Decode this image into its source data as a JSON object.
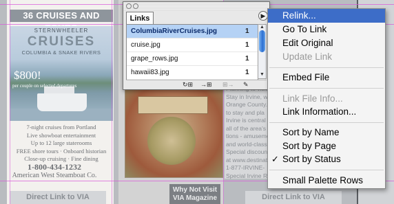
{
  "document": {
    "cruise_header": "36 CRUISES AND TOURS",
    "sternwheeler": "STERNWHEELER",
    "cruises": "CRUISES",
    "rivers": "COLUMBIA & SNAKE RIVERS",
    "price": "$800!",
    "price_note": "per couple on selected departures",
    "description_lines": [
      "7-night cruises from Portland",
      "Live showboat entertainment",
      "Up to 12 large staterooms",
      "FREE shore tours · Onboard historian",
      "Close-up cruising · Fine dining"
    ],
    "phone": "1-800-434-1232",
    "company": "American West Steamboat Co.",
    "direct_link_left": "Direct Link to VIA",
    "direct_link_right": "Direct Link to VIA",
    "why_not_visit": "Why Not Visit\nVIA Magazine",
    "right_text": "Planning to visit\nStay in Irvine, w\nOrange County.\nto stay and pla\nIrvine is central\nall of the area's\ntions - amuseme\nand world-class\nSpecial discount\nat www.destinati\n1-877-IRVINE-\nSpecial Irvine R"
  },
  "links_palette": {
    "tab_label": "Links",
    "menu_button_glyph": "▶",
    "rows": [
      {
        "name": "ColumbiaRiverCruises.jpg",
        "page": "1",
        "selected": true
      },
      {
        "name": "cruise.jpg",
        "page": "1",
        "selected": false
      },
      {
        "name": "grape_rows.jpg",
        "page": "1",
        "selected": false
      },
      {
        "name": "hawaii83.jpg",
        "page": "1",
        "selected": false
      }
    ],
    "scroll_up": "▲",
    "scroll_down": "▼",
    "toolbar": {
      "relink": "↻⊞",
      "goto": "→⊞",
      "update": "⊞→",
      "edit": "✎"
    }
  },
  "context_menu": {
    "items": [
      {
        "label": "Relink...",
        "state": "highlight"
      },
      {
        "label": "Go To Link",
        "state": "normal"
      },
      {
        "label": "Edit Original",
        "state": "normal"
      },
      {
        "label": "Update Link",
        "state": "disabled"
      },
      {
        "label": "Embed File",
        "state": "normal"
      },
      {
        "label": "Link File Info...",
        "state": "disabled"
      },
      {
        "label": "Link Information...",
        "state": "normal"
      },
      {
        "label": "Sort by Name",
        "state": "normal"
      },
      {
        "label": "Sort by Page",
        "state": "normal"
      },
      {
        "label": "Sort by Status",
        "state": "checked"
      },
      {
        "label": "Small Palette Rows",
        "state": "normal"
      }
    ],
    "check_glyph": "✓"
  },
  "colors": {
    "menu_highlight": "#3d6dc8",
    "selected_row": "#b5d2f5",
    "guide": "#d95bd9"
  }
}
